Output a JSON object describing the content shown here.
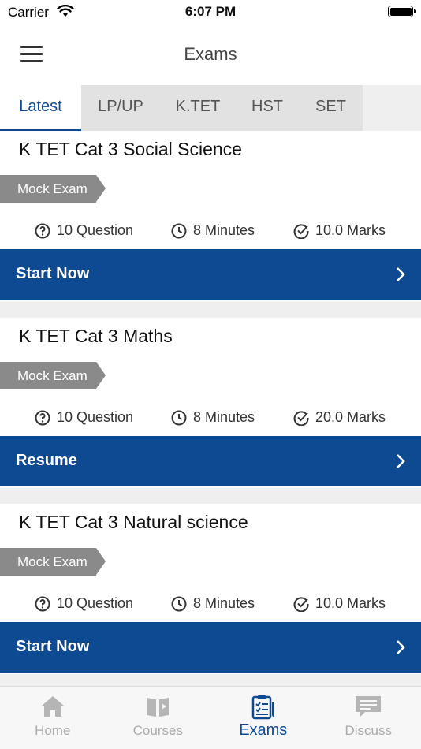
{
  "status": {
    "carrier": "Carrier",
    "time": "6:07 PM"
  },
  "header": {
    "title": "Exams"
  },
  "tabs": [
    {
      "label": "Latest"
    },
    {
      "label": "LP/UP"
    },
    {
      "label": "K.TET"
    },
    {
      "label": "HST"
    },
    {
      "label": "SET"
    }
  ],
  "active_tab": "Latest",
  "exams": [
    {
      "title": "K TET Cat 3 Social Science",
      "badge": "Mock Exam",
      "questions": "10 Question",
      "minutes": "8 Minutes",
      "marks": "10.0 Marks",
      "action": "Start Now"
    },
    {
      "title": "K TET Cat 3 Maths",
      "badge": "Mock Exam",
      "questions": "10 Question",
      "minutes": "8 Minutes",
      "marks": "20.0 Marks",
      "action": "Resume"
    },
    {
      "title": "K TET Cat 3 Natural science",
      "badge": "Mock Exam",
      "questions": "10 Question",
      "minutes": "8 Minutes",
      "marks": "10.0 Marks",
      "action": "Start Now"
    }
  ],
  "bottom_nav": [
    {
      "label": "Home",
      "icon": "home-icon"
    },
    {
      "label": "Courses",
      "icon": "courses-icon"
    },
    {
      "label": "Exams",
      "icon": "exams-icon"
    },
    {
      "label": "Discuss",
      "icon": "discuss-icon"
    }
  ],
  "active_bottom": "Exams",
  "colors": {
    "primary": "#0e4a92",
    "badge": "#8a8a8a",
    "inactive": "#aaaaaa"
  }
}
